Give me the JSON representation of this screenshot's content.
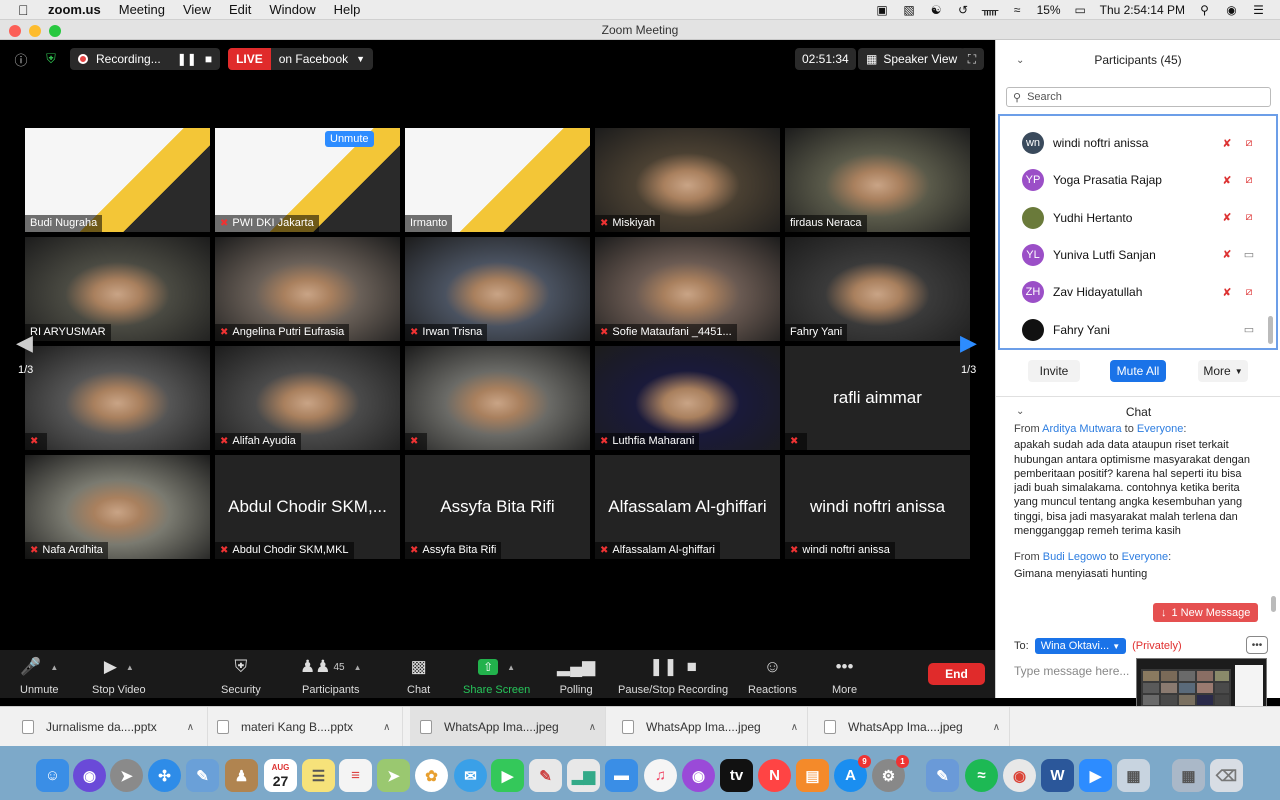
{
  "menubar": {
    "app": "zoom.us",
    "items": [
      "Meeting",
      "View",
      "Edit",
      "Window",
      "Help"
    ],
    "battery": "15%",
    "clock": "Thu 2:54:14 PM"
  },
  "window": {
    "title": "Zoom Meeting"
  },
  "topbar": {
    "recording_label": "Recording...",
    "live_label": "LIVE",
    "live_target": "on Facebook",
    "timer": "02:51:34",
    "view_label": "Speaker View"
  },
  "grid": {
    "page": "1/3",
    "tiles": [
      {
        "name": "Budi Nugraha",
        "muted": false,
        "video": "slide"
      },
      {
        "name": "PWI DKI Jakarta",
        "muted": true,
        "video": "slide",
        "unmute": "Unmute"
      },
      {
        "name": "Irmanto",
        "muted": false,
        "video": "slide"
      },
      {
        "name": "Miskiyah",
        "muted": true,
        "video": "cam"
      },
      {
        "name": "firdaus Neraca",
        "muted": false,
        "video": "cam",
        "active": true
      },
      {
        "name": "RI ARYUSMAR",
        "muted": false,
        "video": "cam"
      },
      {
        "name": "Angelina Putri Eufrasia",
        "muted": true,
        "video": "cam"
      },
      {
        "name": "Irwan Trisna",
        "muted": true,
        "video": "cam"
      },
      {
        "name": "Sofie Mataufani _4451...",
        "muted": true,
        "video": "cam"
      },
      {
        "name": "Fahry Yani",
        "muted": false,
        "video": "cam"
      },
      {
        "name": "",
        "muted": true,
        "video": "cam"
      },
      {
        "name": "Alifah Ayudia",
        "muted": true,
        "video": "cam"
      },
      {
        "name": "",
        "muted": true,
        "video": "cam"
      },
      {
        "name": "Luthfia Maharani",
        "muted": true,
        "video": "cam"
      },
      {
        "name": "",
        "muted": true,
        "video": "none",
        "bigname": "rafli aimmar"
      },
      {
        "name": "Nafa Ardhita",
        "muted": true,
        "video": "cam"
      },
      {
        "name": "Abdul Chodir SKM,MKL",
        "muted": true,
        "video": "none",
        "bigname": "Abdul Chodir SKM,..."
      },
      {
        "name": "Assyfa Bita Rifi",
        "muted": true,
        "video": "none",
        "bigname": "Assyfa Bita Rifi"
      },
      {
        "name": "Alfassalam Al-ghiffari",
        "muted": true,
        "video": "none",
        "bigname": "Alfassalam Al-ghiffari"
      },
      {
        "name": "windi noftri anissa",
        "muted": true,
        "video": "none",
        "bigname": "windi noftri anissa"
      }
    ]
  },
  "toolbar": {
    "unmute": "Unmute",
    "stop_video": "Stop Video",
    "security": "Security",
    "participants": "Participants",
    "participants_count": "45",
    "chat": "Chat",
    "share_screen": "Share Screen",
    "polling": "Polling",
    "pause_stop_recording": "Pause/Stop Recording",
    "reactions": "Reactions",
    "more": "More",
    "end": "End"
  },
  "participants_panel": {
    "title": "Participants (45)",
    "search_placeholder": "Search",
    "items": [
      {
        "initials": "wn",
        "name": "windi noftri anissa",
        "color": "#3a4a5c",
        "mic": "muted",
        "video": "off"
      },
      {
        "initials": "YP",
        "name": "Yoga Prasatia Rajap",
        "color": "#9b4fc7",
        "mic": "muted",
        "video": "off"
      },
      {
        "initials": "",
        "name": "Yudhi Hertanto",
        "color": "#6a7a3a",
        "mic": "muted",
        "video": "off"
      },
      {
        "initials": "YL",
        "name": "Yuniva Lutfi Sanjan",
        "color": "#9b4fc7",
        "mic": "muted",
        "video": "on"
      },
      {
        "initials": "ZH",
        "name": "Zav Hidayatullah",
        "color": "#9b4fc7",
        "mic": "muted",
        "video": "off"
      },
      {
        "initials": "",
        "name": "Fahry Yani",
        "color": "#111111",
        "mic": "none",
        "video": "on"
      }
    ],
    "invite": "Invite",
    "mute_all": "Mute All",
    "more": "More"
  },
  "chat": {
    "title": "Chat",
    "messages": [
      {
        "from": "Arditya Mutwara",
        "to": "Everyone",
        "text": "apakah sudah ada data ataupun riset terkait hubungan antara optimisme masyarakat dengan pemberitaan positif? karena hal seperti itu bisa jadi buah simalakama. contohnya ketika berita yang muncul tentang angka kesembuhan yang tinggi, bisa jadi masyarakat malah terlena dan mengganggap remeh terima kasih"
      },
      {
        "from": "Budi Legowo",
        "to": "Everyone",
        "text": "Gimana menyiasati hunting"
      }
    ],
    "from_label": "From",
    "to_label": "to",
    "new_message": "1 New Message",
    "to_prefix": "To:",
    "recipient": "Wina Oktavi...",
    "privately": "(Privately)",
    "input_placeholder": "Type message here..."
  },
  "downloads": [
    {
      "name": "Jurnalisme da....pptx"
    },
    {
      "name": "materi Kang B....pptx"
    },
    {
      "name": "WhatsApp Ima....jpeg"
    },
    {
      "name": "WhatsApp Ima....jpeg"
    },
    {
      "name": "WhatsApp Ima....jpeg"
    }
  ],
  "dock": {
    "calendar_month": "AUG",
    "calendar_day": "27",
    "appstore_badge": "9",
    "settings_badge": "1"
  }
}
